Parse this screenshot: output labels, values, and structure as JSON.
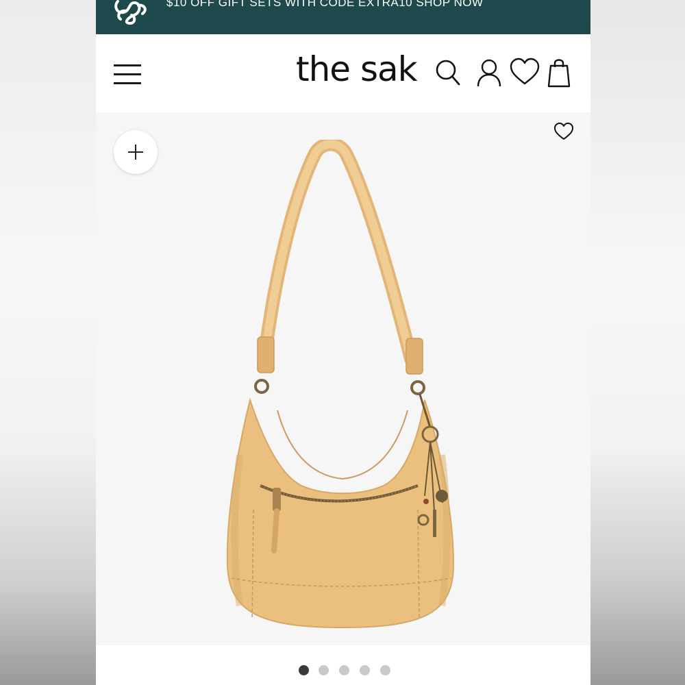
{
  "promo": {
    "text": "$10 OFF GIFT SETS WITH CODE EXTRA10 SHOP NOW",
    "bg_color": "#1f4a4d"
  },
  "header": {
    "brand": "the sak",
    "icons": [
      "menu-icon",
      "search-icon",
      "account-icon",
      "wishlist-icon",
      "shopping-bag-icon"
    ]
  },
  "product": {
    "image": "tan-leather-hobo-bag",
    "zoom_icon": "plus-icon",
    "wishlist_icon": "heart-icon",
    "leather_color": "#ebc07f"
  },
  "carousel": {
    "slide_count": 5,
    "active_index": 0
  }
}
